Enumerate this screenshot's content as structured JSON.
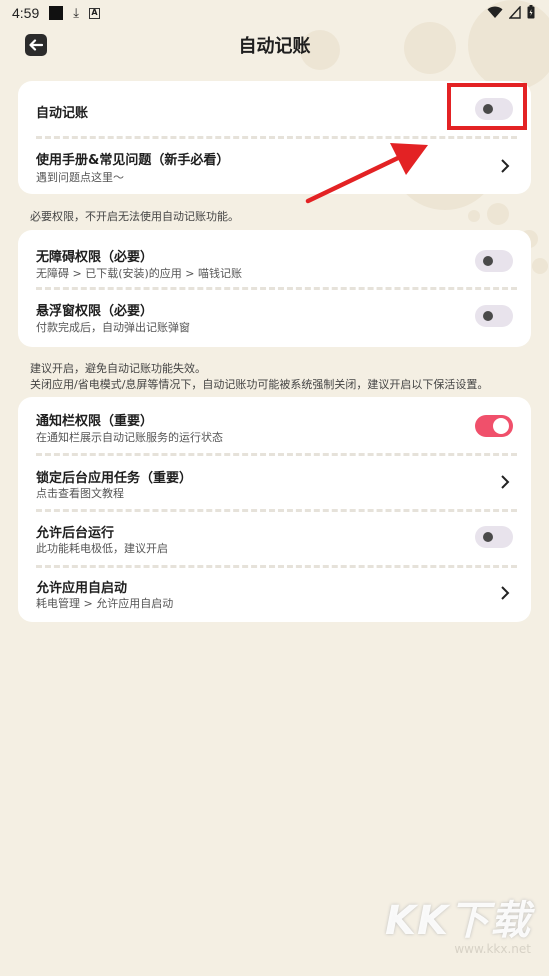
{
  "status_bar": {
    "time": "4:59"
  },
  "header": {
    "title": "自动记账"
  },
  "card_main": {
    "auto_accounting": {
      "title": "自动记账",
      "enabled": false
    },
    "manual": {
      "title": "使用手册&常见问题（新手必看）",
      "subtitle": "遇到问题点这里～"
    }
  },
  "note_required": "必要权限，不开启无法使用自动记账功能。",
  "card_required": [
    {
      "title": "无障碍权限（必要）",
      "subtitle": "无障碍 > 已下载(安装)的应用 > 喵钱记账",
      "enabled": false
    },
    {
      "title": "悬浮窗权限（必要）",
      "subtitle": "付款完成后，自动弹出记账弹窗",
      "enabled": false
    }
  ],
  "note_suggest": {
    "line1": "建议开启，避免自动记账功能失效。",
    "line2": "关闭应用/省电模式/息屏等情况下，自动记账功可能被系统强制关闭，建议开启以下保活设置。"
  },
  "card_suggest": [
    {
      "title": "通知栏权限（重要）",
      "subtitle": "在通知栏展示自动记账服务的运行状态",
      "control": "toggle",
      "enabled": true
    },
    {
      "title": "锁定后台应用任务（重要）",
      "subtitle": "点击查看图文教程",
      "control": "chevron"
    },
    {
      "title": "允许后台运行",
      "subtitle": "此功能耗电极低，建议开启",
      "control": "toggle",
      "enabled": false
    },
    {
      "title": "允许应用自启动",
      "subtitle": "耗电管理 > 允许应用自启动",
      "control": "chevron"
    }
  ],
  "watermark": {
    "main": "KK下载",
    "url": "www.kkx.net"
  },
  "colors": {
    "background": "#f4efe3",
    "toggle_on": "#f0506b",
    "toggle_off": "#e8e3ec",
    "highlight": "#e32224"
  },
  "icons": {
    "back": "arrow-left-icon",
    "chevron": "chevron-right-icon",
    "wifi": "wifi-icon",
    "signal": "signal-icon",
    "battery": "battery-icon",
    "download": "download-icon"
  }
}
